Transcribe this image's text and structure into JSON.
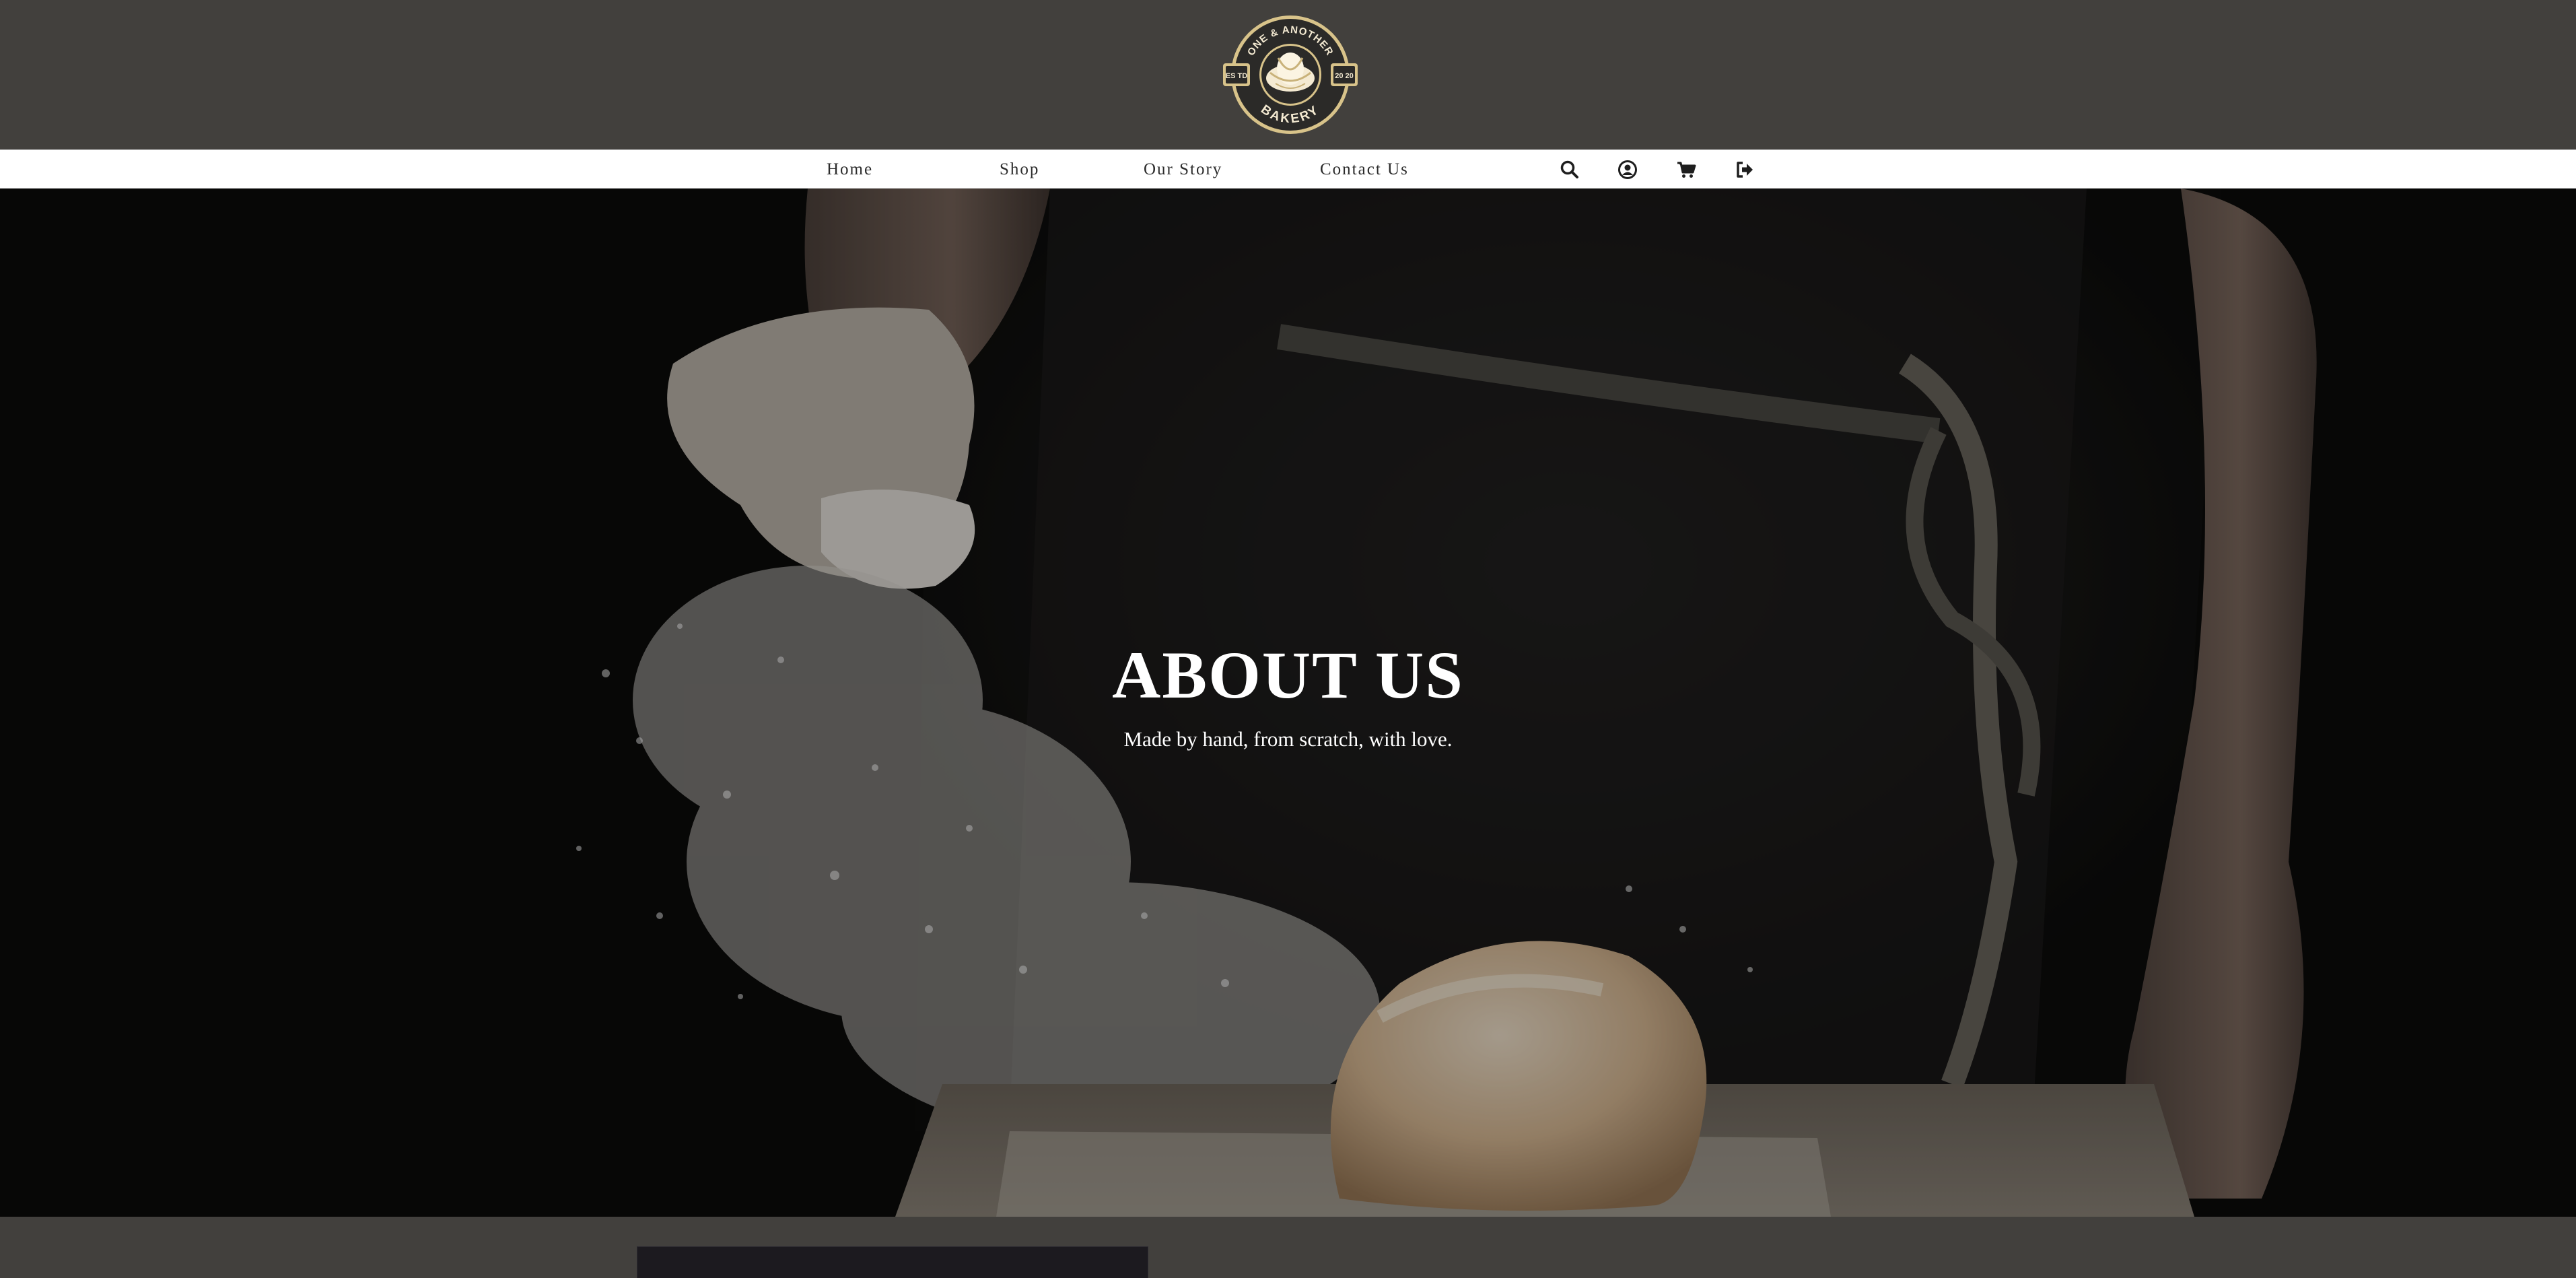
{
  "brand": {
    "logo_top_text": "ONE & ANOTHER",
    "logo_bottom_text": "BAKERY",
    "logo_left_badge": "ES TD",
    "logo_right_badge": "20 20",
    "logo_icon": "croissant-icon",
    "logo_colors": {
      "ring": "#2b2a28",
      "gold": "#d8c38a",
      "cream": "#f4ead2"
    }
  },
  "nav": {
    "links": [
      {
        "label": "Home"
      },
      {
        "label": "Shop"
      },
      {
        "label": "Our Story"
      },
      {
        "label": "Contact Us"
      }
    ],
    "icons": [
      "search-icon",
      "account-icon",
      "cart-icon",
      "logout-icon"
    ]
  },
  "hero": {
    "title": "ABOUT US",
    "subtitle": "Made by hand, from scratch, with love."
  },
  "colors": {
    "page_background": "#42403d",
    "nav_background": "#ffffff",
    "nav_text": "#2b2b2b",
    "hero_text": "#ffffff"
  }
}
